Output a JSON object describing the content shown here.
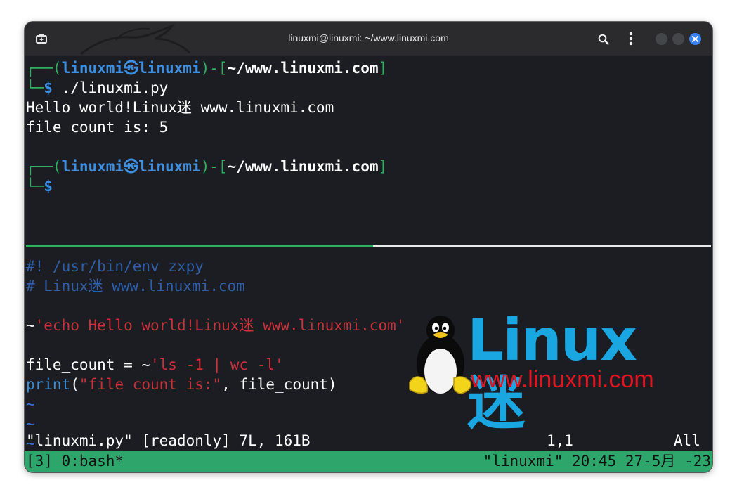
{
  "window": {
    "title": "linuxmi@linuxmi: ~/www.linuxmi.com"
  },
  "prompt1": {
    "open": "┌──(",
    "user": "linuxmi",
    "at": "㉿",
    "host": "linuxmi",
    "mid": ")-[",
    "path": "~/www.linuxmi.com",
    "close": "]",
    "corner": "└─",
    "dollar": "$",
    "command": " ./linuxmi.py"
  },
  "output": [
    "Hello world!Linux迷 www.linuxmi.com",
    "file count is: 5"
  ],
  "prompt2": {
    "open": "┌──(",
    "user": "linuxmi",
    "at": "㉿",
    "host": "linuxmi",
    "mid": ")-[",
    "path": "~/www.linuxmi.com",
    "close": "]",
    "corner": "└─",
    "dollar": "$"
  },
  "vim": {
    "shebang": "#! /usr/bin/env zxpy",
    "comment": "# Linux迷 www.linuxmi.com",
    "echo_tilde": "~",
    "echo_str": "'echo Hello world!Linux迷 www.linuxmi.com'",
    "fc_lhs": "file_count = ~",
    "fc_str": "'ls -1 | wc -l'",
    "print_fn": "print",
    "print_open": "(",
    "print_str": "\"file count is:\"",
    "print_rest": ", file_count)",
    "empty_marker": "~",
    "status_file": "\"linuxmi.py\" [readonly] 7L, 161B",
    "status_pos": "1,1",
    "status_all": "All"
  },
  "tmux": {
    "left": "[3] 0:bash*",
    "right": "\"linuxmi\" 20:45 27-5月 -23"
  },
  "logo": {
    "word": "Linux迷",
    "url": "www.linuxmi.com"
  },
  "colors": {
    "prompt_green": "#2eae5f",
    "user_blue": "#3f8fe0",
    "string_red": "#c9303a",
    "comment_blue": "#2f5fa8",
    "statusbar_green": "#2ea56a",
    "close_button": "#3b82f6"
  },
  "icons": [
    "new-tab-icon",
    "search-icon",
    "kebab-menu-icon",
    "close-icon",
    "tux-penguin-icon",
    "kali-dragon-icon"
  ]
}
